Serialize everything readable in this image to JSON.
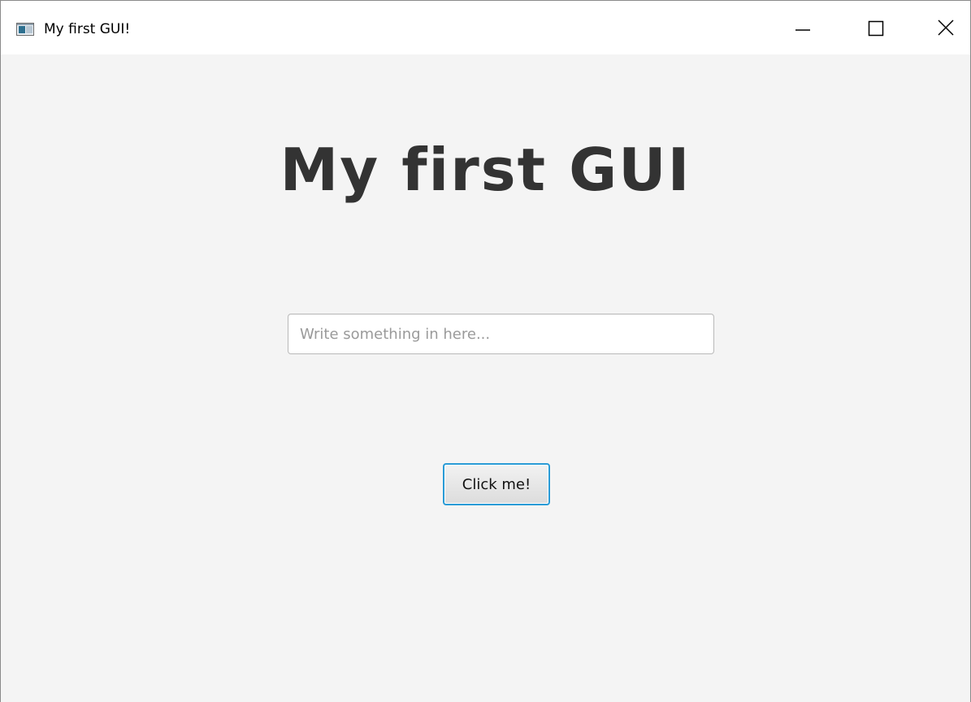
{
  "window": {
    "title": "My first GUI!",
    "controls": {
      "minimize": "minimize-icon",
      "maximize": "maximize-icon",
      "close": "close-icon"
    }
  },
  "main": {
    "heading": "My first GUI",
    "text_field": {
      "value": "",
      "placeholder": "Write something in here..."
    },
    "button_label": "Click me!"
  },
  "colors": {
    "window_background": "#f4f4f4",
    "titlebar_background": "#ffffff",
    "heading_text": "#333333",
    "button_focus_border": "#2a9bd6",
    "placeholder_text": "#9a9a9a"
  }
}
